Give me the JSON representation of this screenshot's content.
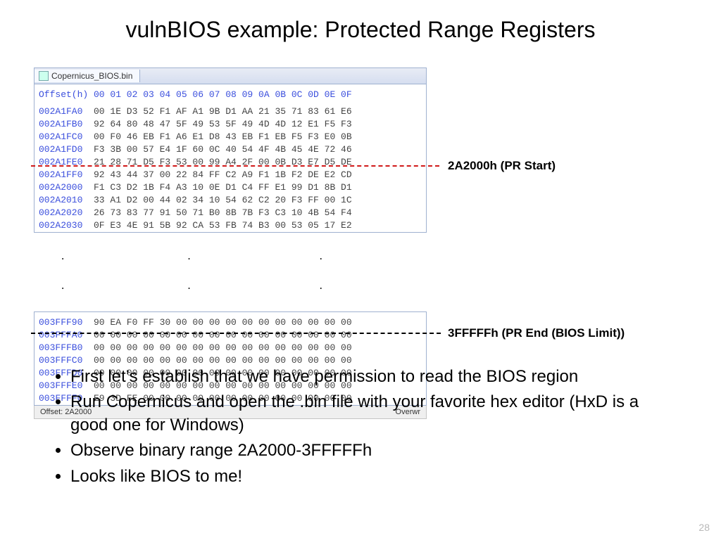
{
  "title": "vulnBIOS example: Protected Range Registers",
  "tab_filename": "Copernicus_BIOS.bin",
  "hex": {
    "header_label": "Offset(h)",
    "cols": "00 01 02 03 04 05 06 07 08 09 0A 0B 0C 0D 0E 0F",
    "top": [
      {
        "off": "002A1FA0",
        "b": "00 1E D3 52 F1 AF A1 9B D1 AA 21 35 71 83 61 E6"
      },
      {
        "off": "002A1FB0",
        "b": "92 64 80 48 47 5F 49 53 5F 49 4D 4D 12 E1 F5 F3"
      },
      {
        "off": "002A1FC0",
        "b": "00 F0 46 EB F1 A6 E1 D8 43 EB F1 EB F5 F3 E0 0B"
      },
      {
        "off": "002A1FD0",
        "b": "F3 3B 00 57 E4 1F 60 0C 40 54 4F 4B 45 4E 72 46"
      },
      {
        "off": "002A1FE0",
        "b": "21 28 71 D5 F3 53 00 99 A4 2F 00 0B D3 E7 D5 DE"
      },
      {
        "off": "002A1FF0",
        "b": "92 43 44 37 00 22 84 FF C2 A9 F1 1B F2 DE E2 CD"
      },
      {
        "off": "002A2000",
        "b": "F1 C3 D2 1B F4 A3 10 0E D1 C4 FF E1 99 D1 8B D1"
      },
      {
        "off": "002A2010",
        "b": "33 A1 D2 00 44 02 34 10 54 62 C2 20 F3 FF 00 1C"
      },
      {
        "off": "002A2020",
        "b": "26 73 83 77 91 50 71 B0 8B 7B F3 C3 10 4B 54 F4"
      },
      {
        "off": "002A2030",
        "b": "0F E3 4E 91 5B 92 CA 53 FB 74 B3 00 53 05 17 E2"
      }
    ],
    "bottom": [
      {
        "off": "003FFF90",
        "b": "90 EA F0 FF 30 00 00 00 00 00 00 00 00 00 00 00"
      },
      {
        "off": "003FFFA0",
        "b": "00 00 00 00 00 00 00 00 00 00 00 00 00 00 00 00"
      },
      {
        "off": "003FFFB0",
        "b": "00 00 00 00 00 00 00 00 00 00 00 00 00 00 00 00"
      },
      {
        "off": "003FFFC0",
        "b": "00 00 00 00 00 00 00 00 00 00 00 00 00 00 00 00"
      },
      {
        "off": "003FFFD0",
        "b": "00 00 00 00 00 00 00 00 00 00 00 00 00 00 00 00"
      },
      {
        "off": "003FFFE0",
        "b": "00 00 00 00 00 00 00 00 00 00 00 00 00 00 00 00"
      },
      {
        "off": "003FFFF0",
        "b": "E9 3D FE 00 00 00 00 00 00 00 00 00 00 00 00 00"
      }
    ]
  },
  "dots_row": "    .                      .                       .",
  "label_start": "2A2000h (PR Start)",
  "label_end": "3FFFFFh (PR End (BIOS Limit))",
  "status_left": "Offset: 2A2000",
  "status_right": "Overwr",
  "bullets": [
    "First let’s establish that we have permission to read the BIOS region",
    "Run Copernicus and open the .bin file with your favorite hex editor (HxD is a good one for Windows)",
    "Observe binary range 2A2000-3FFFFFh",
    "Looks like BIOS to me!"
  ],
  "page_number": "28"
}
